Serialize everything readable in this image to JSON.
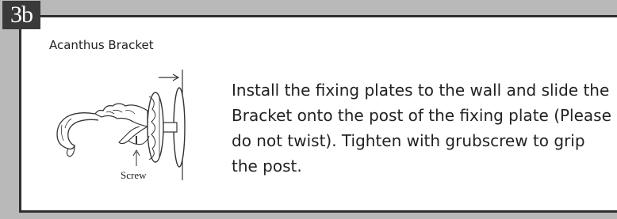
{
  "step": {
    "label": "3b"
  },
  "section": {
    "title": "Acanthus Bracket"
  },
  "illustration": {
    "screw_label": "Screw"
  },
  "instructions": {
    "text": "Install the fixing plates to the wall and slide the Bracket onto the post of the fixing plate (Please do not twist). Tighten with grubscrew to grip the post."
  }
}
